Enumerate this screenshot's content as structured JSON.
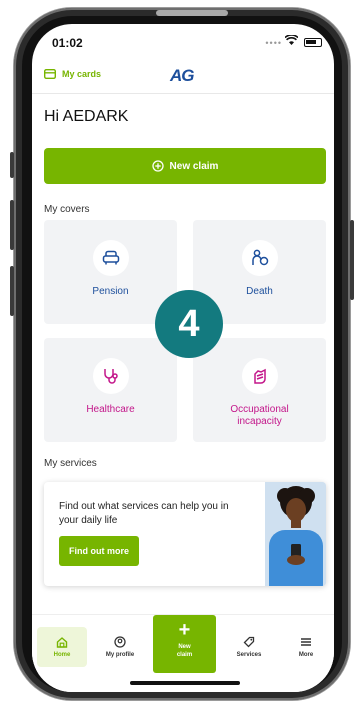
{
  "status_bar": {
    "time": "01:02"
  },
  "header": {
    "my_cards_label": "My cards",
    "logo_text": "AG"
  },
  "greeting": "Hi AEDARK",
  "new_claim_button": "New claim",
  "covers": {
    "title": "My covers",
    "items": [
      {
        "label": "Pension",
        "icon": "couch-icon",
        "color": "#1d4f9c"
      },
      {
        "label": "Death",
        "icon": "people-icon",
        "color": "#1d4f9c"
      },
      {
        "label": "Healthcare",
        "icon": "stethoscope-icon",
        "color": "#c3168a"
      },
      {
        "label": "Occupational incapacity",
        "icon": "bandaged-hand-icon",
        "color": "#c3168a"
      }
    ]
  },
  "step_badge": "4",
  "services": {
    "title": "My services",
    "text": "Find out what services can help you in your daily life",
    "button": "Find out more"
  },
  "bottom_nav": {
    "home": "Home",
    "profile": "My profile",
    "new_claim_line1": "New",
    "new_claim_line2": "claim",
    "services": "Services",
    "more": "More"
  },
  "colors": {
    "brand_green": "#77b500",
    "brand_blue": "#1d4f9c",
    "accent_pink": "#c3168a",
    "badge_teal": "#137a7f"
  }
}
